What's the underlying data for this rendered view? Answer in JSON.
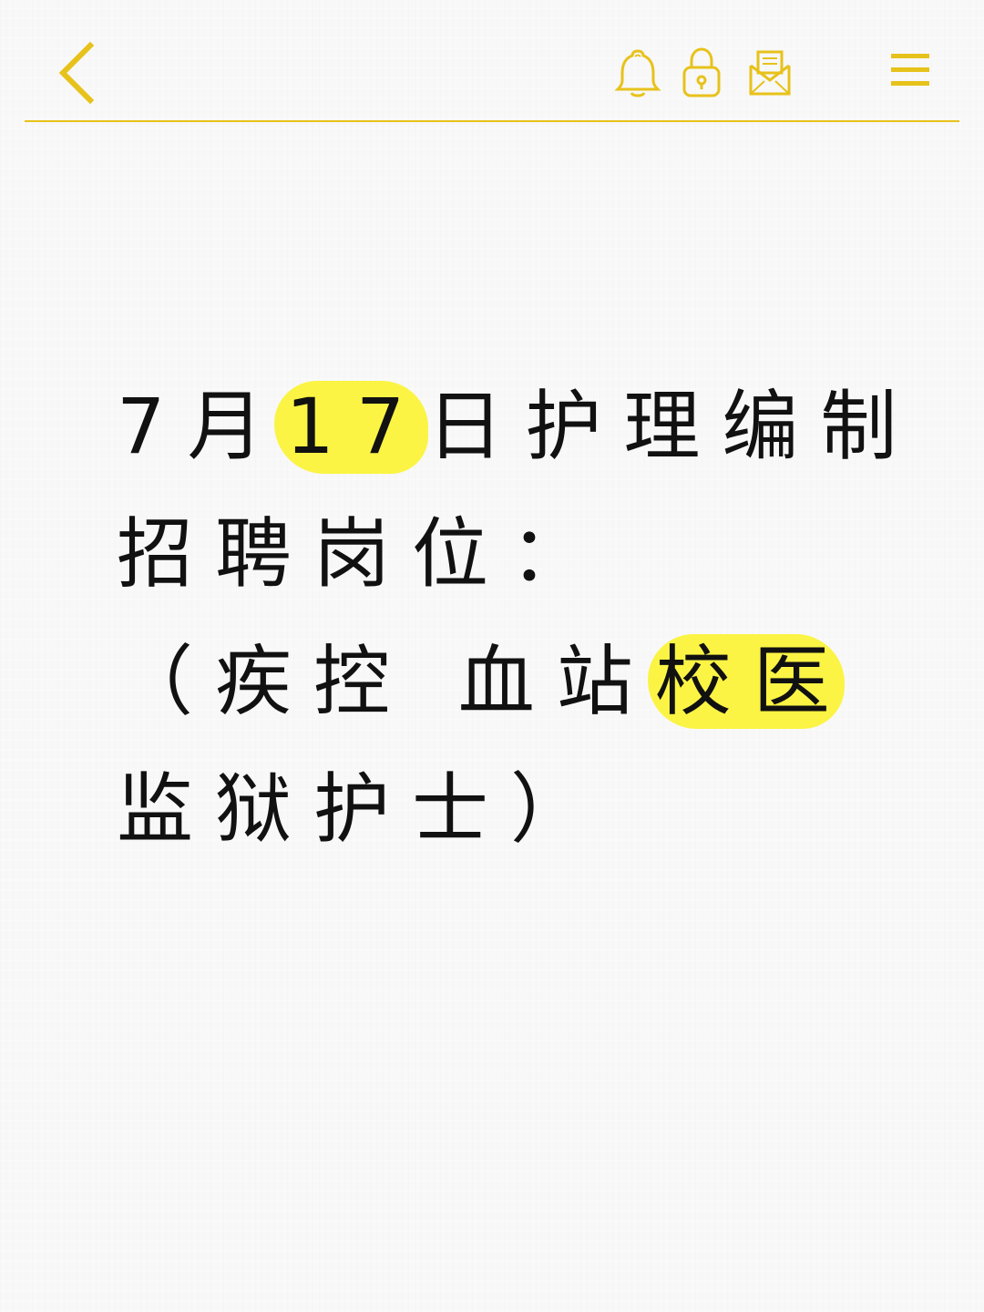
{
  "header": {
    "back_icon": "chevron-left-icon",
    "bell_icon": "bell-icon",
    "lock_icon": "lock-icon",
    "mail_icon": "mail-icon",
    "menu_icon": "menu-icon",
    "accent_color": "#e7c21b"
  },
  "body": {
    "line1_a": "7月",
    "line1_highlight": "17",
    "line1_b": "日护理编制",
    "line2": "招聘岗位：",
    "line3_a": "（疾控 血站",
    "line3_highlight": " 校医",
    "line4": "监狱护士）",
    "highlight_color": "#fbf33a",
    "text_color": "#111111"
  }
}
